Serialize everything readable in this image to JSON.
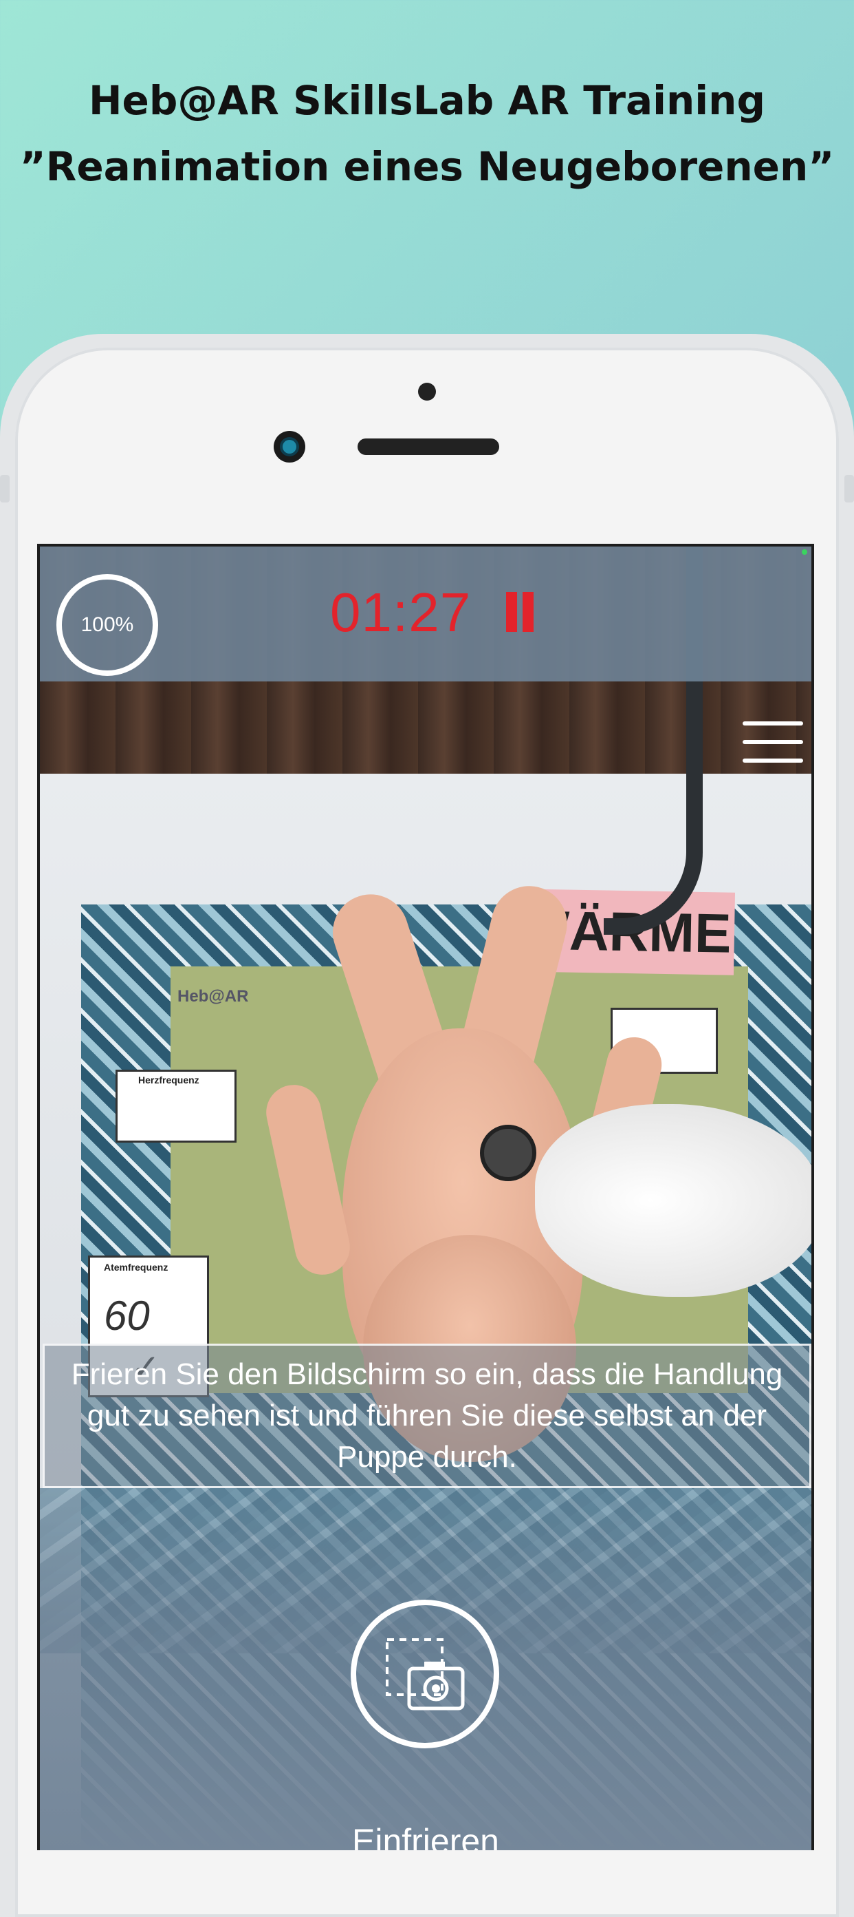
{
  "promo": {
    "title_line1": "Heb@AR SkillsLab AR Training",
    "title_line2": "”Reanimation eines Neugeborenen”"
  },
  "hud": {
    "progress_label": "100%",
    "progress_value": 1.0,
    "timer": "01:27",
    "timer_color": "#e3232b"
  },
  "scene": {
    "sign_text": "WÄRME",
    "mat_brand": "Heb@AR",
    "card_herz": "Herzfrequenz",
    "card_atem": "Atemfrequenz",
    "card_atem_value": "60"
  },
  "instruction": {
    "text": "Frieren Sie den Bildschirm so ein, dass die Handlung gut zu sehen ist und führen Sie diese selbst an der Puppe durch."
  },
  "freeze": {
    "label": "Einfrieren"
  }
}
